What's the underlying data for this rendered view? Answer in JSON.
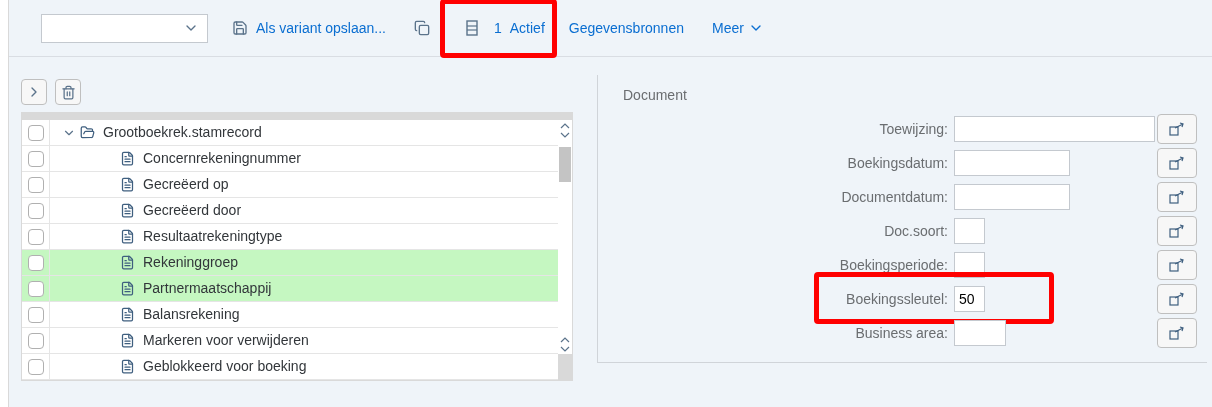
{
  "toolbar": {
    "items": [
      {
        "kind": "select"
      },
      {
        "kind": "save",
        "label": "Als variant opslaan...",
        "highlighted": false
      },
      {
        "kind": "copy",
        "highlighted": false
      },
      {
        "kind": "active",
        "count": "1",
        "label": "Actief",
        "highlighted": true
      },
      {
        "kind": "link",
        "label": "Gegevensbronnen",
        "highlighted": false
      },
      {
        "kind": "menu",
        "label": "Meer",
        "highlighted": false
      }
    ]
  },
  "tree": {
    "root": {
      "label": "Grootboekrek.stamrecord",
      "expanded": true,
      "checked": false,
      "selected": false,
      "children": [
        {
          "label": "Concernrekeningnummer",
          "checked": false,
          "selected": false
        },
        {
          "label": "Gecreëerd op",
          "checked": false,
          "selected": false
        },
        {
          "label": "Gecreëerd door",
          "checked": false,
          "selected": false
        },
        {
          "label": "Resultaatrekeningtype",
          "checked": false,
          "selected": false
        },
        {
          "label": "Rekeninggroep",
          "checked": false,
          "selected": true
        },
        {
          "label": "Partnermaatschappij",
          "checked": false,
          "selected": true
        },
        {
          "label": "Balansrekening",
          "checked": false,
          "selected": false
        },
        {
          "label": "Markeren voor verwijderen",
          "checked": false,
          "selected": false
        },
        {
          "label": "Geblokkeerd voor boeking",
          "checked": false,
          "selected": false
        }
      ]
    }
  },
  "form": {
    "title": "Document",
    "fields": [
      {
        "label": "Toewijzing:",
        "kind": "text",
        "highlighted": false
      },
      {
        "label": "Boekingsdatum:",
        "kind": "date",
        "highlighted": false
      },
      {
        "label": "Documentdatum:",
        "kind": "date",
        "highlighted": false
      },
      {
        "label": "Doc.soort:",
        "kind": "code",
        "highlighted": false
      },
      {
        "label": "Boekingsperiode:",
        "kind": "code",
        "highlighted": false
      },
      {
        "label": "Boekingssleutel:",
        "kind": "code",
        "value": "50",
        "highlighted": true
      },
      {
        "label": "Business area:",
        "kind": "area",
        "highlighted": false
      }
    ]
  }
}
